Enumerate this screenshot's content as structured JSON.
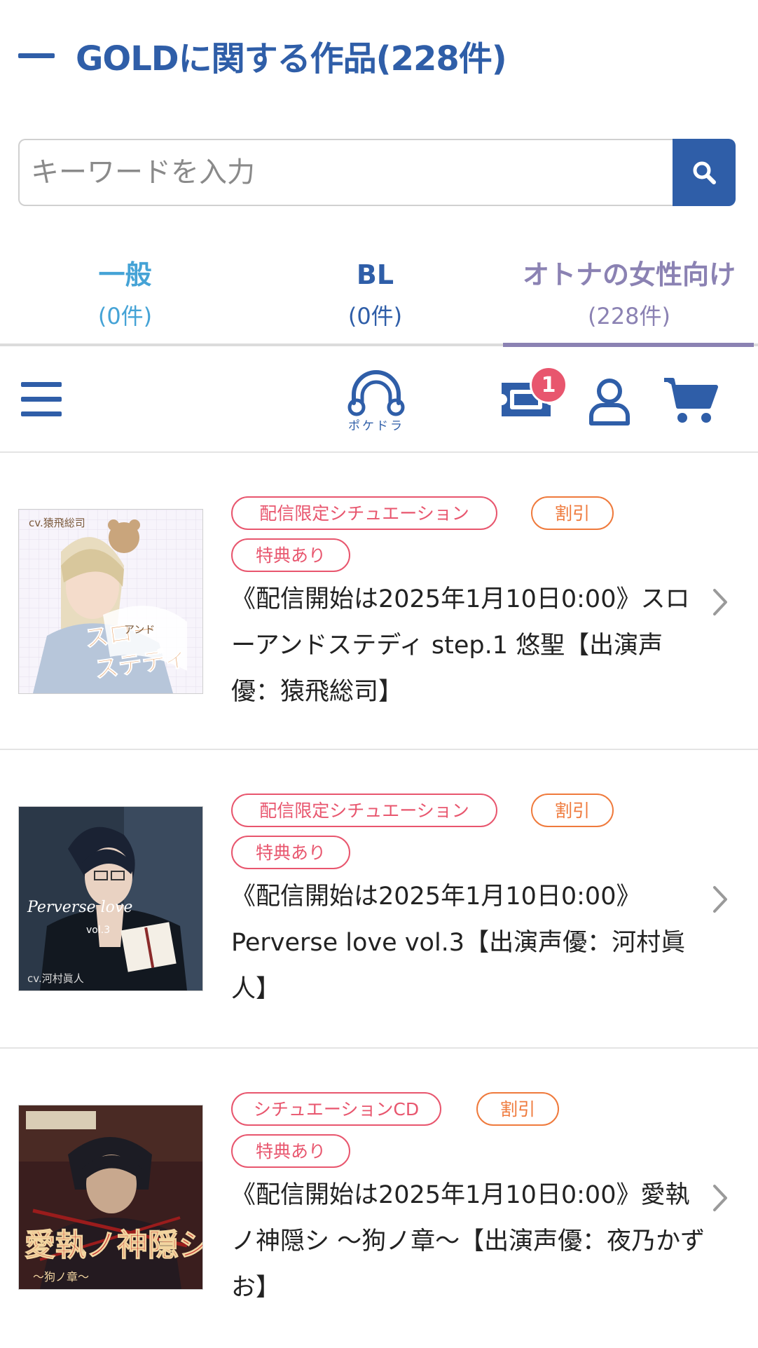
{
  "header": {
    "title": "GOLDに関する作品(228件)"
  },
  "search": {
    "placeholder": "キーワードを入力"
  },
  "tabs": [
    {
      "label": "一般",
      "count": "(0件)"
    },
    {
      "label": "BL",
      "count": "(0件)"
    },
    {
      "label": "オトナの女性向け",
      "count": "(228件)"
    }
  ],
  "appbar": {
    "logo_text": "ポケドラ",
    "ticket_badge": "1"
  },
  "items": [
    {
      "tags": [
        "配信限定シチュエーション",
        "割引",
        "特典あり"
      ],
      "title": "《配信開始は2025年1月10日0:00》スローアンドステディ step.1 悠聖【出演声優：猿飛総司】",
      "thumb_texts": [
        "cv.猿飛総司",
        "スロー",
        "アンド",
        "ステディ"
      ]
    },
    {
      "tags": [
        "配信限定シチュエーション",
        "割引",
        "特典あり"
      ],
      "title": "《配信開始は2025年1月10日0:00》Perverse love vol.3【出演声優：河村眞人】",
      "thumb_texts": [
        "Perverse love",
        "vol.3",
        "cv.河村眞人"
      ]
    },
    {
      "tags": [
        "シチュエーションCD",
        "割引",
        "特典あり"
      ],
      "title": "《配信開始は2025年1月10日0:00》愛執ノ神隠シ 〜狗ノ章〜【出演声優：夜乃かずお】",
      "thumb_texts": [
        "愛執ノ神隠シ",
        "〜狗ノ章〜"
      ]
    }
  ],
  "colors": {
    "primary": "#2f5ea8",
    "tab_general": "#45a3d6",
    "tab_adult": "#8b82b3",
    "tag_pink": "#e8566e",
    "tag_orange": "#ef7a3c"
  },
  "icons": [
    "minus-icon",
    "search-icon",
    "menu-icon",
    "headphones-logo-icon",
    "ticket-icon",
    "user-icon",
    "cart-icon",
    "chevron-right-icon"
  ]
}
